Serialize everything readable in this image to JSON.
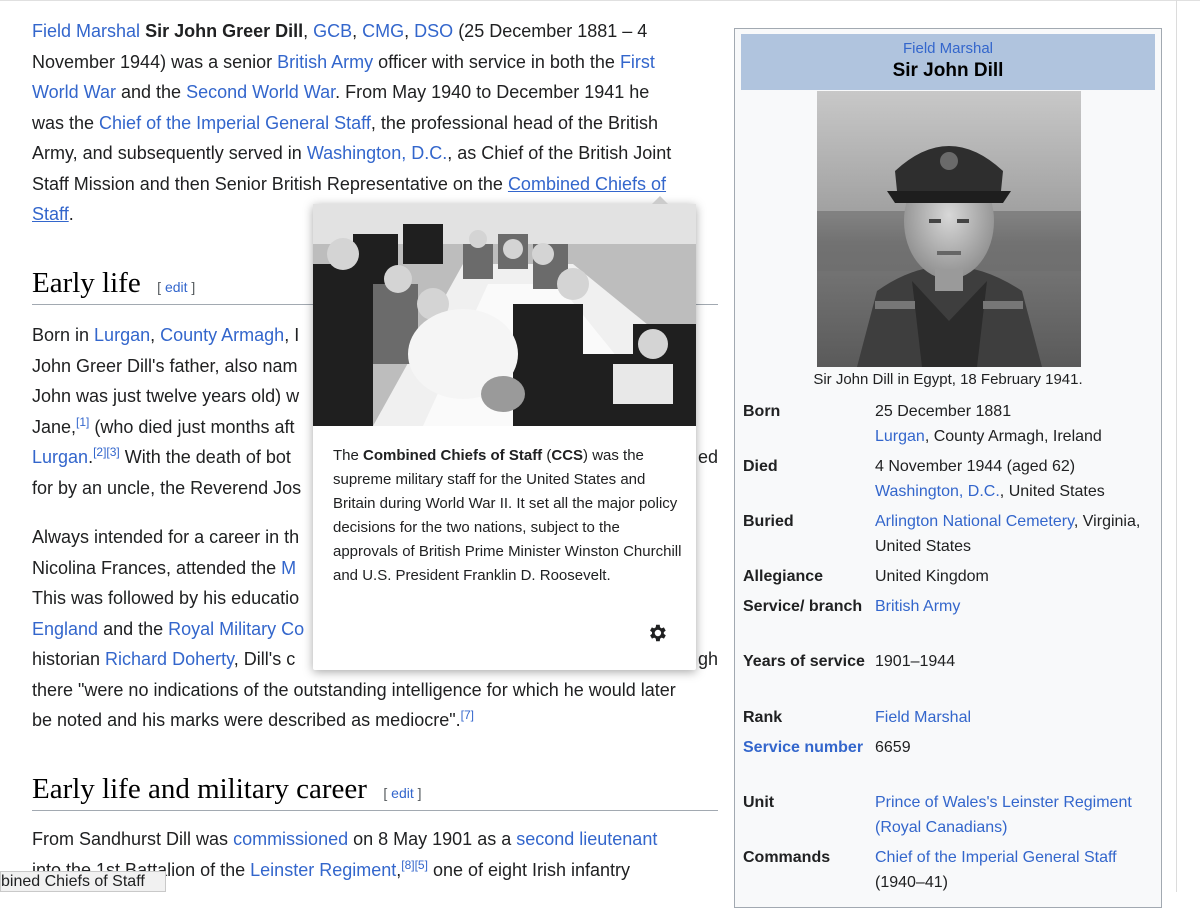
{
  "article": {
    "intro": [
      [
        {
          "t": "Field Marshal",
          "link": true
        },
        {
          "t": " "
        },
        {
          "t": "Sir John Greer Dill",
          "bold": true
        },
        {
          "t": ", "
        },
        {
          "t": "GCB",
          "link": true
        },
        {
          "t": ", "
        },
        {
          "t": "CMG",
          "link": true
        },
        {
          "t": ", "
        },
        {
          "t": "DSO",
          "link": true
        },
        {
          "t": " (25 December 1881 – 4"
        }
      ],
      [
        {
          "t": "November 1944) was a senior "
        },
        {
          "t": "British Army",
          "link": true
        },
        {
          "t": " officer with service in both the "
        },
        {
          "t": "First",
          "link": true
        }
      ],
      [
        {
          "t": "World War",
          "link": true
        },
        {
          "t": " and the "
        },
        {
          "t": "Second World War",
          "link": true
        },
        {
          "t": ". From May 1940 to December 1941 he"
        }
      ],
      [
        {
          "t": "was the "
        },
        {
          "t": "Chief of the Imperial General Staff",
          "link": true
        },
        {
          "t": ", the professional head of the British"
        }
      ],
      [
        {
          "t": "Army, and subsequently served in "
        },
        {
          "t": "Washington, D.C.",
          "link": true
        },
        {
          "t": ", as Chief of the British Joint"
        }
      ],
      [
        {
          "t": "Staff Mission and then Senior British Representative on the "
        },
        {
          "t": "Combined Chiefs of",
          "link": true,
          "u": true
        }
      ],
      [
        {
          "t": "Staff",
          "link": true,
          "u": true
        },
        {
          "t": "."
        }
      ]
    ],
    "heading1": "Early life",
    "heading1_edit": "edit",
    "early": [
      [
        {
          "t": "Born in "
        },
        {
          "t": "Lurgan",
          "link": true
        },
        {
          "t": ", "
        },
        {
          "t": "County Armagh",
          "link": true
        },
        {
          "t": ", I"
        }
      ],
      [
        {
          "t": "John Greer Dill's father, also nam"
        }
      ],
      [
        {
          "t": "John was just twelve years old) w"
        }
      ],
      [
        {
          "t": "Jane,"
        },
        {
          "t": "[1]",
          "sup": true,
          "link": true
        },
        {
          "t": " (who died just months aft"
        }
      ],
      [
        {
          "t": "Lurgan",
          "link": true
        },
        {
          "t": "."
        },
        {
          "t": "[2]",
          "sup": true,
          "link": true
        },
        {
          "t": "[3]",
          "sup": true,
          "link": true
        },
        {
          "t": " With the death of bot"
        }
      ],
      [
        {
          "t": "for by an uncle, the Reverend Jos"
        }
      ]
    ],
    "early_right": [
      {
        "line": 4,
        "t": "ed"
      }
    ],
    "para2": [
      [
        {
          "t": "Always intended for a career in th"
        }
      ],
      [
        {
          "t": "Nicolina Frances, attended the "
        },
        {
          "t": "M",
          "link": true
        }
      ],
      [
        {
          "t": "This was followed by his educatio"
        }
      ],
      [
        {
          "t": "England",
          "link": true
        },
        {
          "t": " and the "
        },
        {
          "t": "Royal Military Co",
          "link": true
        }
      ],
      [
        {
          "t": "historian "
        },
        {
          "t": "Richard Doherty",
          "link": true
        },
        {
          "t": ", Dill's c"
        }
      ],
      [
        {
          "t": "there \"were no indications of the outstanding intelligence for which he would later"
        }
      ],
      [
        {
          "t": "be noted and his marks were described as mediocre\"."
        },
        {
          "t": "[7]",
          "sup": true,
          "link": true
        }
      ]
    ],
    "para2_right": [
      {
        "line": 4,
        "t": "gh"
      }
    ],
    "heading2": "Early life and military career",
    "heading2_edit": "edit",
    "para3": [
      [
        {
          "t": "From Sandhurst Dill was "
        },
        {
          "t": "commissioned",
          "link": true
        },
        {
          "t": " on 8 May 1901 as a "
        },
        {
          "t": "second lieutenant",
          "link": true
        }
      ],
      [
        {
          "t": "into the 1st Battalion of the "
        },
        {
          "t": "Leinster Regiment",
          "link": true
        },
        {
          "t": ","
        },
        {
          "t": "[8]",
          "sup": true,
          "link": true
        },
        {
          "t": "[5]",
          "sup": true,
          "link": true
        },
        {
          "t": " one of eight Irish infantry"
        }
      ]
    ]
  },
  "infobox": {
    "rank": "Field Marshal",
    "name": "Sir John Dill",
    "caption": "Sir John Dill in Egypt, 18 February 1941.",
    "rows": [
      {
        "label": "Born",
        "lines": [
          [
            {
              "t": "25 December 1881"
            }
          ],
          [
            {
              "t": "Lurgan",
              "link": true
            },
            {
              "t": ", County Armagh, Ireland"
            }
          ]
        ]
      },
      {
        "label": "Died",
        "lines": [
          [
            {
              "t": "4 November 1944 (aged 62)"
            }
          ],
          [
            {
              "t": "Washington, D.C.",
              "link": true
            },
            {
              "t": ", United States"
            }
          ]
        ]
      },
      {
        "label": "Buried",
        "lines": [
          [
            {
              "t": "Arlington National Cemetery",
              "link": true
            },
            {
              "t": ", Virginia,"
            }
          ],
          [
            {
              "t": "United States"
            }
          ]
        ]
      },
      {
        "label": "Allegiance",
        "lines": [
          [
            {
              "t": "United Kingdom"
            }
          ]
        ]
      },
      {
        "label": "Service/ branch",
        "lines": [
          [
            {
              "t": "British Army",
              "link": true
            }
          ]
        ]
      },
      {
        "label": "Years of service",
        "lines": [
          [
            {
              "t": "1901–1944"
            }
          ]
        ]
      },
      {
        "label": "Rank",
        "lines": [
          [
            {
              "t": "Field Marshal",
              "link": true
            }
          ]
        ]
      },
      {
        "label": "Service number",
        "label_link": true,
        "lines": [
          [
            {
              "t": "6659"
            }
          ]
        ]
      },
      {
        "label": "Unit",
        "lines": [
          [
            {
              "t": "Prince of Wales's Leinster Regiment",
              "link": true
            }
          ],
          [
            {
              "t": "(Royal Canadians)",
              "link": true
            }
          ]
        ]
      },
      {
        "label": "Commands",
        "lines": [
          [
            {
              "t": "Chief of the Imperial General Staff",
              "link": true
            }
          ],
          [
            {
              "t": "(1940–41)"
            }
          ]
        ]
      }
    ]
  },
  "popup": {
    "text": [
      {
        "t": "The "
      },
      {
        "t": "Combined Chiefs of Staff",
        "bold": true
      },
      {
        "t": " ("
      },
      {
        "t": "CCS",
        "bold": true
      },
      {
        "t": ") was the supreme military staff for the United States and Britain during World War II. It set all the major policy decisions for the two nations, subject to the approvals of British Prime Minister Winston Churchill and U.S. President Franklin D. Roosevelt."
      }
    ],
    "settings_icon": "gear-icon"
  },
  "status_bar": "bined Chiefs of Staff",
  "colors": {
    "link": "#3366cc",
    "infobox_header": "#b0c4de",
    "infobox_bg": "#f8f9fa"
  }
}
